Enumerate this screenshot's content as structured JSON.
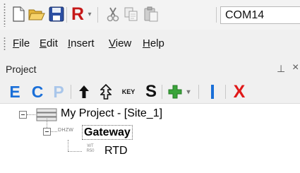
{
  "toolbar": {
    "items": [
      "new-file-icon",
      "open-folder-icon",
      "save-disk-icon",
      "r-menu-icon",
      "cut-icon",
      "copy-icon",
      "paste-icon"
    ],
    "r_label": "R",
    "port_value": "COM14"
  },
  "menubar": {
    "items": [
      {
        "label": "File",
        "accel": "F"
      },
      {
        "label": "Edit",
        "accel": "E"
      },
      {
        "label": "Insert",
        "accel": "I"
      },
      {
        "label": "View",
        "accel": "V"
      },
      {
        "label": "Help",
        "accel": "H"
      }
    ]
  },
  "panel": {
    "title": "Project",
    "pin_glyph": "⊥",
    "close_glyph": "×"
  },
  "project_toolbar": {
    "e_label": "E",
    "c_label": "C",
    "p_label": "P",
    "key_label": "KEY",
    "s_label": "S",
    "delete_label": "X",
    "colors": {
      "blue": "#1a6fd8",
      "red": "#e01818",
      "green": "#3aa43a",
      "gray_p": "#a9c6ea"
    }
  },
  "tree": {
    "root": {
      "label": "My Project - [Site_1]"
    },
    "gateway": {
      "tag": "DHZW",
      "label": "Gateway"
    },
    "device": {
      "tag_top": "WT",
      "tag_bottom": "R50",
      "label": "RTD"
    }
  }
}
